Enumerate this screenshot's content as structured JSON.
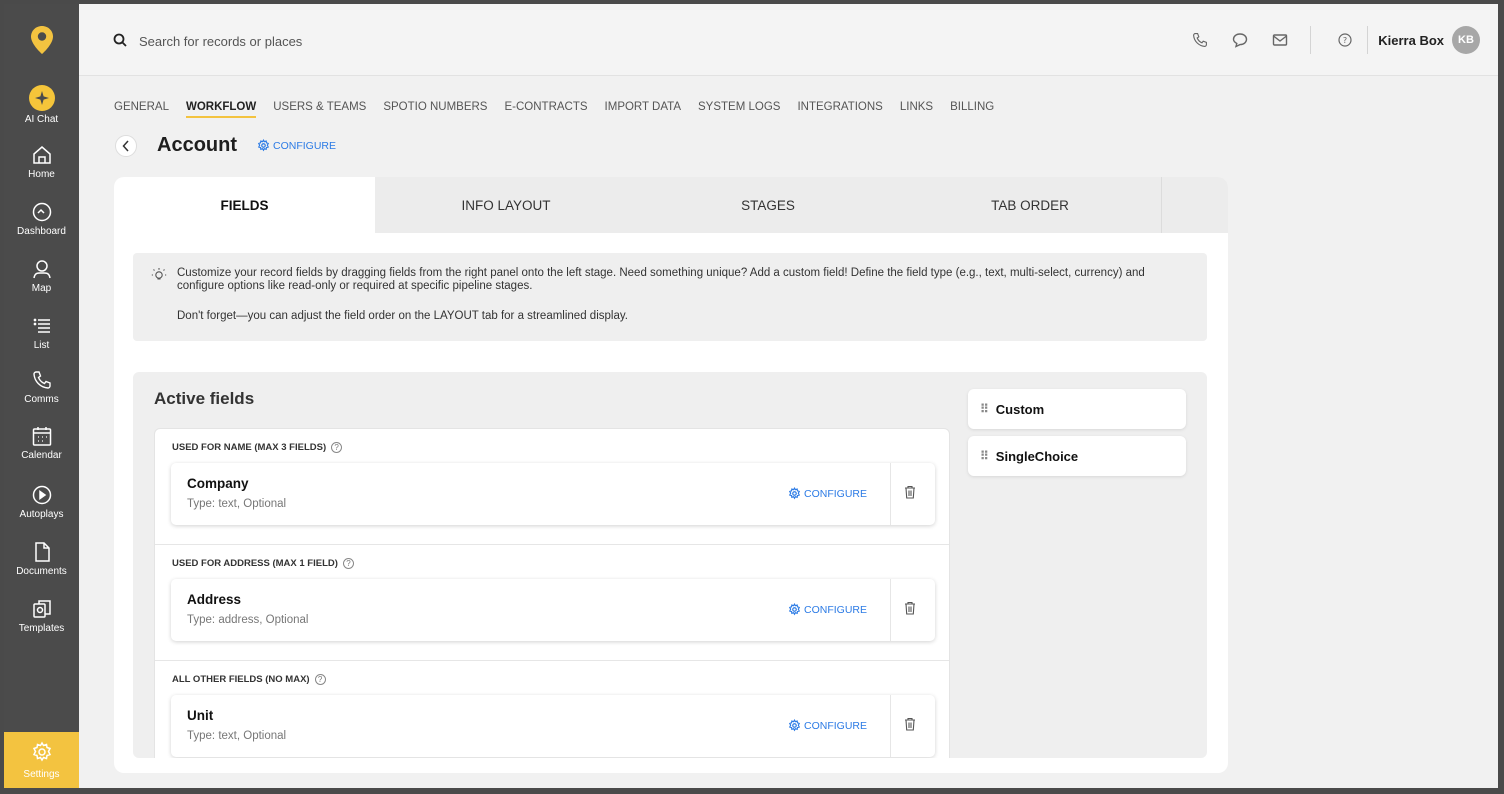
{
  "colors": {
    "accent_yellow": "#f3c340",
    "link_blue": "#2c7be5",
    "sidebar_bg": "#4b4b4b"
  },
  "sidebar": {
    "items": [
      {
        "label": "AI Chat",
        "icon": "ai-sparkle-icon"
      },
      {
        "label": "Home",
        "icon": "home-icon"
      },
      {
        "label": "Dashboard",
        "icon": "dashboard-gauge-icon"
      },
      {
        "label": "Map",
        "icon": "map-pin-icon"
      },
      {
        "label": "List",
        "icon": "list-icon"
      },
      {
        "label": "Comms",
        "icon": "phone-icon"
      },
      {
        "label": "Calendar",
        "icon": "calendar-icon"
      },
      {
        "label": "Autoplays",
        "icon": "play-circle-icon"
      },
      {
        "label": "Documents",
        "icon": "document-icon"
      },
      {
        "label": "Templates",
        "icon": "templates-icon"
      }
    ],
    "settings_label": "Settings"
  },
  "topbar": {
    "search_placeholder": "Search for records or places",
    "user_name": "Kierra Box",
    "user_initials": "KB"
  },
  "settings_tabs": [
    "GENERAL",
    "WORKFLOW",
    "USERS & TEAMS",
    "SPOTIO NUMBERS",
    "E-CONTRACTS",
    "IMPORT DATA",
    "SYSTEM LOGS",
    "INTEGRATIONS",
    "LINKS",
    "BILLING"
  ],
  "active_settings_tab": "WORKFLOW",
  "page": {
    "title": "Account",
    "configure_label": "CONFIGURE"
  },
  "card_tabs": [
    "FIELDS",
    "INFO LAYOUT",
    "STAGES",
    "TAB ORDER"
  ],
  "active_card_tab": "FIELDS",
  "info": {
    "line1": "Customize your record fields by dragging fields from the right panel onto the left stage. Need something unique? Add a custom field! Define the field type (e.g., text, multi-select, currency) and configure options like read-only or required at specific pipeline stages.",
    "line2": "Don't forget—you can adjust the field order on the LAYOUT tab for a streamlined display."
  },
  "active_fields": {
    "title": "Active fields",
    "sections": [
      {
        "label": "USED FOR NAME (MAX 3 FIELDS)",
        "field": {
          "name": "Company",
          "type": "Type: text, Optional",
          "configure": "CONFIGURE"
        }
      },
      {
        "label": "USED FOR ADDRESS (MAX 1 FIELD)",
        "field": {
          "name": "Address",
          "type": "Type: address, Optional",
          "configure": "CONFIGURE"
        }
      },
      {
        "label": "ALL OTHER FIELDS (NO MAX)",
        "field": {
          "name": "Unit",
          "type": "Type: text, Optional",
          "configure": "CONFIGURE"
        }
      }
    ]
  },
  "available_fields": [
    "Custom",
    "SingleChoice"
  ]
}
